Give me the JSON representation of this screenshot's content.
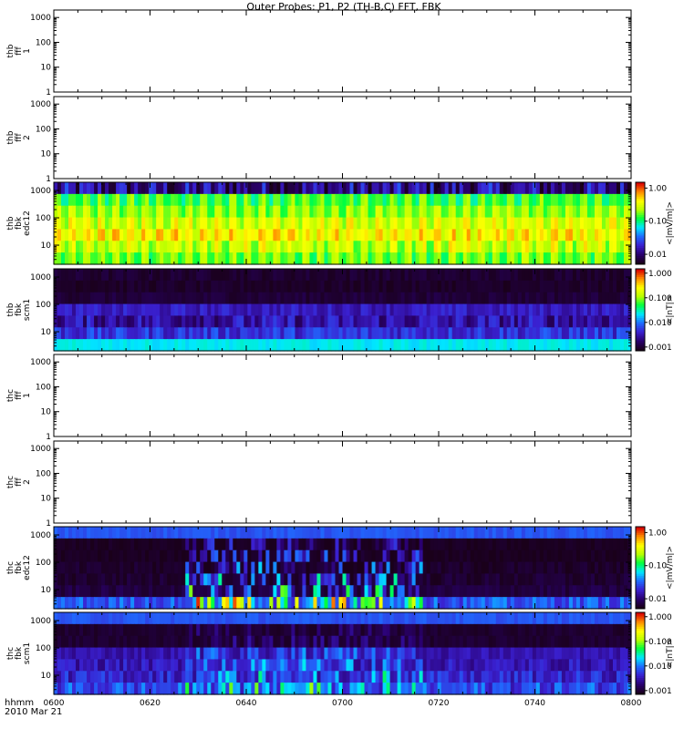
{
  "title": "Outer Probes: P1, P2 (TH-B,C) FFT, FBK",
  "time_axis": {
    "row_label": "hhmm",
    "date_label": "2010 Mar 21",
    "ticks": [
      "0600",
      "0620",
      "0640",
      "0700",
      "0720",
      "0740",
      "0800"
    ]
  },
  "colors": {
    "axis": "#000000",
    "colorbar_stops": [
      "#1a001a",
      "#2a0070",
      "#3a20d0",
      "#1f6cff",
      "#00e8ff",
      "#00ff40",
      "#b8ff00",
      "#ffff00",
      "#ff8c00",
      "#d80000"
    ]
  },
  "chart_data": [
    {
      "type": "heatmap",
      "ylabel": [
        "thb",
        "fff",
        "1"
      ],
      "yticks": [
        "1000",
        "100",
        "10",
        "1"
      ],
      "ylim": [
        1,
        2000
      ],
      "yscale": "log",
      "has_data": false
    },
    {
      "type": "heatmap",
      "ylabel": [
        "thb",
        "fff",
        "2"
      ],
      "yticks": [
        "1000",
        "100",
        "10",
        "1"
      ],
      "ylim": [
        1,
        2000
      ],
      "yscale": "log",
      "has_data": false
    },
    {
      "type": "heatmap",
      "ylabel": [
        "thb",
        "fbk",
        "edc12"
      ],
      "yticks": [
        "1000",
        "100",
        "10"
      ],
      "ylim": [
        2,
        2000
      ],
      "yscale": "log",
      "has_data": true,
      "colorbar": {
        "label": "<|mV/m|>",
        "ticks": [
          "1.00",
          "0.10",
          "0.01"
        ],
        "range": [
          0.005,
          1.5
        ]
      },
      "bands": [
        {
          "level": 0.13,
          "variation": 0.35
        },
        {
          "level": 0.58,
          "variation": 0.1
        },
        {
          "level": 0.65,
          "variation": 0.08
        },
        {
          "level": 0.72,
          "variation": 0.1
        },
        {
          "level": 0.78,
          "variation": 0.12
        },
        {
          "level": 0.7,
          "variation": 0.14
        },
        {
          "level": 0.62,
          "variation": 0.1
        }
      ],
      "pattern": "periodic"
    },
    {
      "type": "heatmap",
      "ylabel": [
        "thb",
        "fbk",
        "scm1"
      ],
      "yticks": [
        "1000",
        "100",
        "10"
      ],
      "ylim": [
        2,
        2000
      ],
      "yscale": "log",
      "has_data": true,
      "colorbar": {
        "label": "<|nT|>",
        "ticks": [
          "1.000",
          "0.100",
          "0.010",
          "0.001"
        ],
        "range": [
          0.0007,
          1.5
        ]
      },
      "bands": [
        {
          "level": 0.03,
          "variation": 0.05
        },
        {
          "level": 0.02,
          "variation": 0.04
        },
        {
          "level": 0.04,
          "variation": 0.05
        },
        {
          "level": 0.2,
          "variation": 0.1
        },
        {
          "level": 0.17,
          "variation": 0.2
        },
        {
          "level": 0.25,
          "variation": 0.15
        },
        {
          "level": 0.45,
          "variation": 0.05
        }
      ],
      "pattern": "steady"
    },
    {
      "type": "heatmap",
      "ylabel": [
        "thc",
        "fff",
        "1"
      ],
      "yticks": [
        "1000",
        "100",
        "10",
        "1"
      ],
      "ylim": [
        1,
        2000
      ],
      "yscale": "log",
      "has_data": false
    },
    {
      "type": "heatmap",
      "ylabel": [
        "thc",
        "fff",
        "2"
      ],
      "yticks": [
        "1000",
        "100",
        "10",
        "1"
      ],
      "ylim": [
        1,
        2000
      ],
      "yscale": "log",
      "has_data": false
    },
    {
      "type": "heatmap",
      "ylabel": [
        "thc",
        "fbk",
        "edc12"
      ],
      "yticks": [
        "1000",
        "100",
        "10"
      ],
      "ylim": [
        2,
        2000
      ],
      "yscale": "log",
      "has_data": true,
      "colorbar": {
        "label": "<|mV/m|>",
        "ticks": [
          "1.00",
          "0.10",
          "0.01"
        ],
        "range": [
          0.005,
          1.5
        ]
      },
      "bands": [
        {
          "level": 0.3,
          "variation": 0.05
        },
        {
          "level": 0.01,
          "variation": 0.03
        },
        {
          "level": 0.01,
          "variation": 0.03
        },
        {
          "level": 0.02,
          "variation": 0.05
        },
        {
          "level": 0.03,
          "variation": 0.06
        },
        {
          "level": 0.05,
          "variation": 0.06
        },
        {
          "level": 0.3,
          "variation": 0.15
        }
      ],
      "pattern": "burst",
      "burst_range": [
        "0627",
        "0716"
      ]
    },
    {
      "type": "heatmap",
      "ylabel": [
        "thc",
        "fbk",
        "scm1"
      ],
      "yticks": [
        "1000",
        "100",
        "10"
      ],
      "ylim": [
        2,
        2000
      ],
      "yscale": "log",
      "has_data": true,
      "colorbar": {
        "label": "<|nT|>",
        "ticks": [
          "1.000",
          "0.100",
          "0.010",
          "0.001"
        ],
        "range": [
          0.0007,
          1.5
        ]
      },
      "bands": [
        {
          "level": 0.3,
          "variation": 0.05
        },
        {
          "level": 0.03,
          "variation": 0.04
        },
        {
          "level": 0.03,
          "variation": 0.04
        },
        {
          "level": 0.18,
          "variation": 0.08
        },
        {
          "level": 0.19,
          "variation": 0.12
        },
        {
          "level": 0.22,
          "variation": 0.15
        },
        {
          "level": 0.28,
          "variation": 0.2
        }
      ],
      "pattern": "mild_burst",
      "burst_range": [
        "0627",
        "0716"
      ]
    }
  ]
}
